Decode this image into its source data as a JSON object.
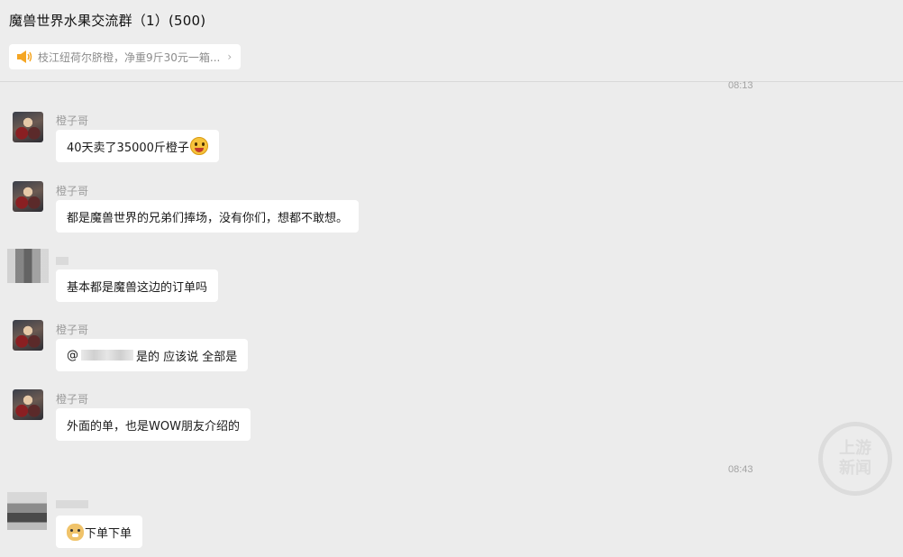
{
  "header": {
    "title": "魔兽世界水果交流群（1）(500)",
    "notice_text": "枝江纽荷尔脐橙，净重9斤30元一箱...",
    "notice_chevron": "›"
  },
  "icons": {
    "notice": "speaker-icon",
    "chevron": "chevron-right-icon"
  },
  "colors": {
    "notice_icon": "#f5a623",
    "bubble": "#ffffff",
    "background": "#ececec"
  },
  "timestamps": {
    "t1": "08:13",
    "t2": "08:43"
  },
  "messages": [
    {
      "sender": "橙子哥",
      "text": "40天卖了35000斤橙子",
      "emoji": "grinning-face-emoji"
    },
    {
      "sender": "橙子哥",
      "text": "都是魔兽世界的兄弟们捧场，没有你们，想都不敢想。"
    },
    {
      "sender": "",
      "text": "基本都是魔兽这边的订单吗"
    },
    {
      "sender": "橙子哥",
      "text_prefix": "@",
      "text_suffix": "是的 应该说 全部是"
    },
    {
      "sender": "橙子哥",
      "text": "外面的单，也是WOW朋友介绍的"
    },
    {
      "sender": "",
      "text": "下单下单",
      "emoji": "doge-emoji"
    }
  ],
  "watermark": {
    "line1": "上游",
    "line2": "新闻"
  }
}
